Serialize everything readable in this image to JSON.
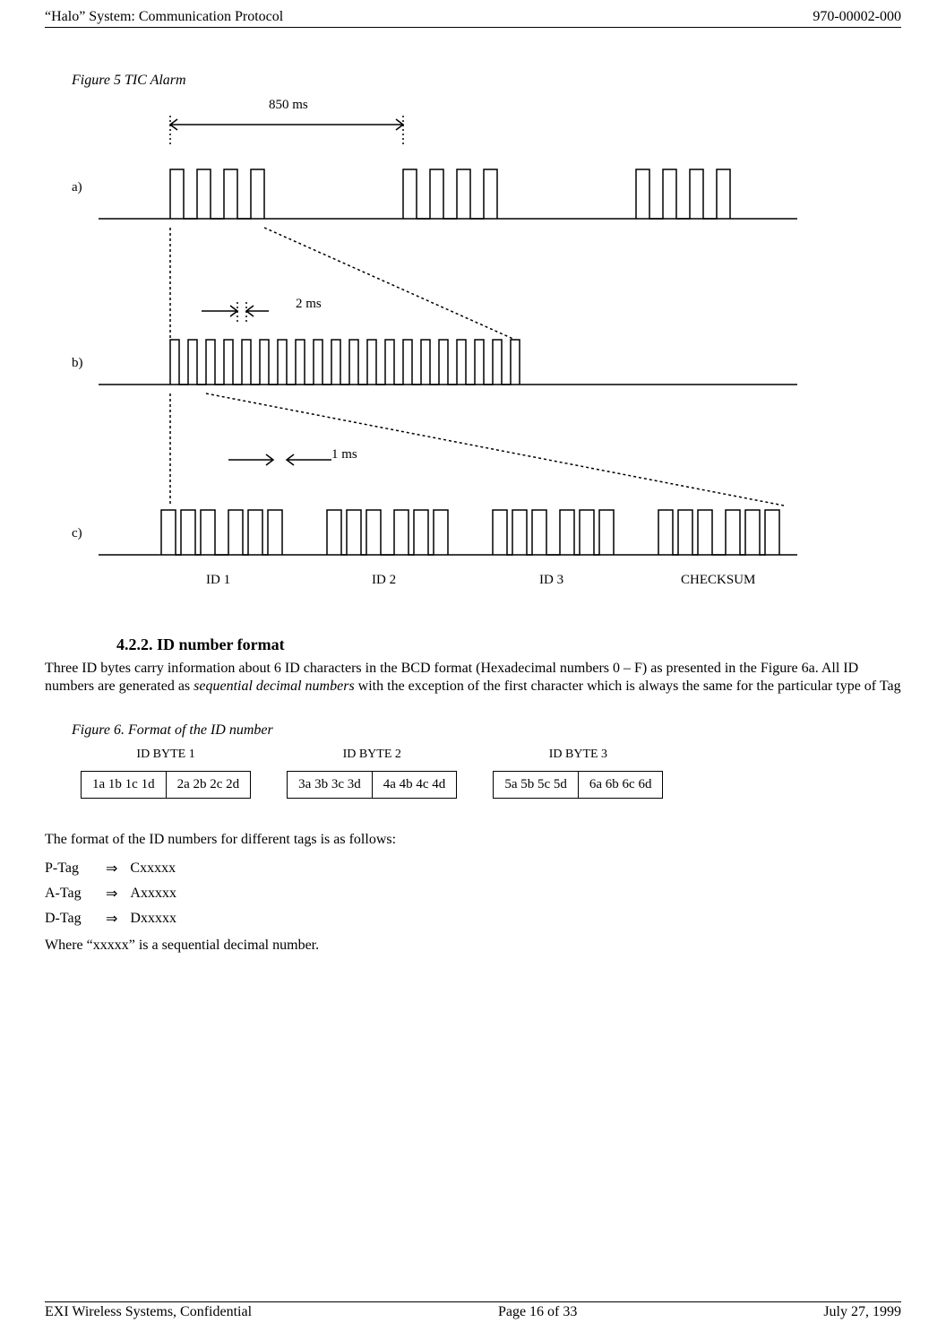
{
  "header": {
    "left": "“Halo” System: Communication Protocol",
    "right": "970-00002-000"
  },
  "figure5": {
    "caption": "Figure 5  TIC Alarm",
    "labels": {
      "t850": "850 ms",
      "t2": "2 ms",
      "t1": "1 ms",
      "a": "a)",
      "b": "b)",
      "c": "c)",
      "id1": "ID 1",
      "id2": "ID 2",
      "id3": "ID 3",
      "checksum": "CHECKSUM"
    }
  },
  "section": {
    "num_title": "4.2.2.   ID number format",
    "para1_a": "Three ID bytes carry information about 6 ID characters in the BCD format (Hexadecimal numbers 0 – F) as presented in the Figure 6a. All ID numbers are generated as ",
    "para1_b": "sequential decimal numbers",
    "para1_c": " with the exception of the first character which is always the same for the particular type of Tag"
  },
  "figure6": {
    "caption": "Figure 6. Format of the ID number",
    "bytes": [
      {
        "title": "ID BYTE 1",
        "cells": [
          "1a 1b 1c 1d",
          "2a 2b 2c 2d"
        ]
      },
      {
        "title": "ID BYTE 2",
        "cells": [
          "3a 3b 3c 3d",
          "4a 4b 4c 4d"
        ]
      },
      {
        "title": "ID BYTE 3",
        "cells": [
          "5a 5b 5c 5d",
          "6a 6b 6c 6d"
        ]
      }
    ]
  },
  "tagfmt": {
    "intro": "The format of the ID numbers for different tags is as follows:",
    "rows": [
      {
        "name": "P-Tag",
        "value": "Cxxxxx"
      },
      {
        "name": "A-Tag",
        "value": "Axxxxx"
      },
      {
        "name": "D-Tag",
        "value": "Dxxxxx"
      }
    ],
    "arrow": "⇒",
    "note": "Where “xxxxx” is a sequential decimal number."
  },
  "footer": {
    "left": "EXI Wireless Systems, Confidential",
    "center": "Page 16 of 33",
    "right": "July 27, 1999"
  }
}
